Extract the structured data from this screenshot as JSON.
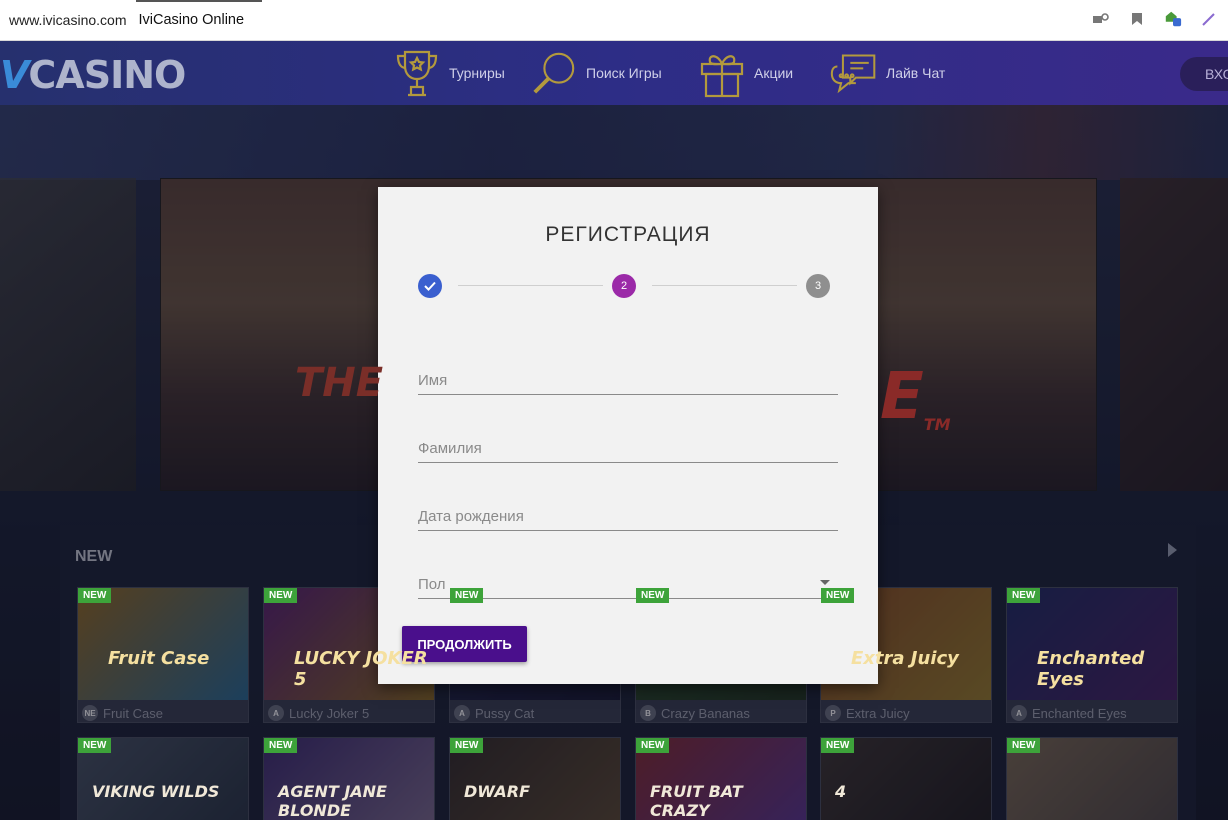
{
  "browser": {
    "url": "www.ivicasino.com",
    "tab_title": "IviCasino Online",
    "icons": [
      "key-icon",
      "bookmark-icon",
      "extension-icon",
      "pen-icon"
    ]
  },
  "nav": {
    "logo_prefix": "V",
    "logo_text": "CASINO",
    "items": [
      {
        "label": "Турниры",
        "icon": "trophy-icon"
      },
      {
        "label": "Поиск Игры",
        "icon": "magnifier-icon"
      },
      {
        "label": "Акции",
        "icon": "gift-icon"
      },
      {
        "label": "Лайв Чат",
        "icon": "chat-icon"
      }
    ],
    "login_label": "ВХО"
  },
  "banner": {
    "text_left": "THE",
    "text_right": "E",
    "tm": "TM"
  },
  "games": {
    "section_title": "NEW",
    "badge": "NEW",
    "row1": [
      {
        "name": "Fruit Case",
        "provider": "NE",
        "art": "Fruit Case",
        "color_a": "#e8a020",
        "color_b": "#3aa0d8"
      },
      {
        "name": "Lucky Joker 5",
        "provider": "A",
        "art": "LUCKY JOKER 5",
        "color_a": "#8a2aa0",
        "color_b": "#d8a020"
      },
      {
        "name": "Pussy Cat",
        "provider": "A",
        "art": "",
        "color_a": "#2a2a5a",
        "color_b": "#1a1a3a"
      },
      {
        "name": "Crazy Bananas",
        "provider": "B",
        "art": "",
        "color_a": "#3a6a2a",
        "color_b": "#2a4a1a"
      },
      {
        "name": "Extra Juicy",
        "provider": "P",
        "art": "Extra Juicy",
        "color_a": "#d87020",
        "color_b": "#f0c030"
      },
      {
        "name": "Enchanted Eyes",
        "provider": "A",
        "art": "Enchanted Eyes",
        "color_a": "#2a3a8a",
        "color_b": "#6a2a8a"
      }
    ],
    "row2": [
      {
        "art": "VIKING WILDS",
        "color_a": "#6a7a8a",
        "color_b": "#3a4a5a"
      },
      {
        "art": "AGENT JANE BLONDE",
        "color_a": "#5a3aa0",
        "color_b": "#c0a0d0"
      },
      {
        "art": "DWARF",
        "color_a": "#4a3a2a",
        "color_b": "#8a6a3a"
      },
      {
        "art": "FRUIT BAT CRAZY",
        "color_a": "#d03a3a",
        "color_b": "#8a4ad0"
      },
      {
        "art": "4",
        "color_a": "#5a4a3a",
        "color_b": "#2a221a"
      },
      {
        "art": "",
        "color_a": "#c0a070",
        "color_b": "#7a6a5a"
      }
    ]
  },
  "modal": {
    "title": "РЕГИСТРАЦИЯ",
    "steps": [
      {
        "label": "",
        "state": "done",
        "color": "#3a5fcf"
      },
      {
        "label": "2",
        "state": "active",
        "color": "#9b2aa8"
      },
      {
        "label": "3",
        "state": "pending",
        "color": "#8f8f8f"
      }
    ],
    "fields": {
      "first_name_placeholder": "Имя",
      "last_name_placeholder": "Фамилия",
      "dob_placeholder": "Дата рождения",
      "gender_placeholder": "Пол"
    },
    "continue_label": "ПРОДОЛЖИТЬ",
    "accent": "#4a0f8c"
  }
}
